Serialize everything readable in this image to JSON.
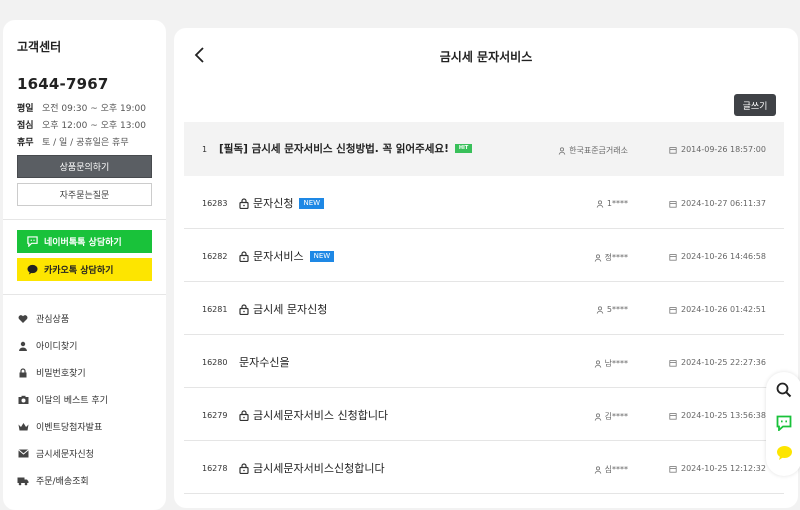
{
  "sidebar": {
    "title": "고객센터",
    "phone": "1644-7967",
    "hours": [
      {
        "label": "평일",
        "value": "오전 09:30 ~ 오후 19:00"
      },
      {
        "label": "점심",
        "value": "오후 12:00 ~ 오후 13:00"
      },
      {
        "label": "휴무",
        "value": "토 / 일 / 공휴일은 휴무"
      }
    ],
    "product_inquiry_label": "상품문의하기",
    "faq_label": "자주묻는질문",
    "naver_talk_label": "네이버톡톡 상담하기",
    "kakao_talk_label": "카카오톡 상담하기",
    "menu": [
      {
        "label": "관심상품",
        "icon": "heart-icon"
      },
      {
        "label": "아이디찾기",
        "icon": "user-icon"
      },
      {
        "label": "비밀번호찾기",
        "icon": "lock-icon"
      },
      {
        "label": "이달의 베스트 후기",
        "icon": "camera-icon"
      },
      {
        "label": "이벤트당첨자발표",
        "icon": "crown-icon"
      },
      {
        "label": "금시세문자신청",
        "icon": "mail-icon"
      },
      {
        "label": "주문/배송조회",
        "icon": "truck-icon"
      }
    ],
    "colors": {
      "naver": "#19c23a",
      "kakao": "#fde500"
    }
  },
  "main": {
    "title": "금시세 문자서비스",
    "write_label": "글쓰기",
    "posts": [
      {
        "no": "1",
        "subject": "[필독] 금시세 문자서비스 신청방법. 꼭 읽어주세요!",
        "badge": "HIT",
        "author": "한국표준금거래소",
        "date": "2014-09-26 18:57:00",
        "locked": false,
        "notice": true
      },
      {
        "no": "16283",
        "subject": "문자신청",
        "badge": "NEW",
        "author": "1****",
        "date": "2024-10-27 06:11:37",
        "locked": true
      },
      {
        "no": "16282",
        "subject": "문자서비스",
        "badge": "NEW",
        "author": "정****",
        "date": "2024-10-26 14:46:58",
        "locked": true
      },
      {
        "no": "16281",
        "subject": "금시세 문자신청",
        "badge": "",
        "author": "5****",
        "date": "2024-10-26 01:42:51",
        "locked": true
      },
      {
        "no": "16280",
        "subject": "문자수신을",
        "badge": "",
        "author": "남****",
        "date": "2024-10-25 22:27:36",
        "locked": false
      },
      {
        "no": "16279",
        "subject": "금시세문자서비스 신청합니다",
        "badge": "",
        "author": "김****",
        "date": "2024-10-25 13:56:38",
        "locked": true
      },
      {
        "no": "16278",
        "subject": "금시세문자서비스신청합니다",
        "badge": "",
        "author": "심****",
        "date": "2024-10-25 12:12:32",
        "locked": true
      }
    ]
  },
  "float_bar": {
    "icons": [
      "search-icon",
      "naver-talk-icon",
      "kakao-talk-icon"
    ]
  }
}
